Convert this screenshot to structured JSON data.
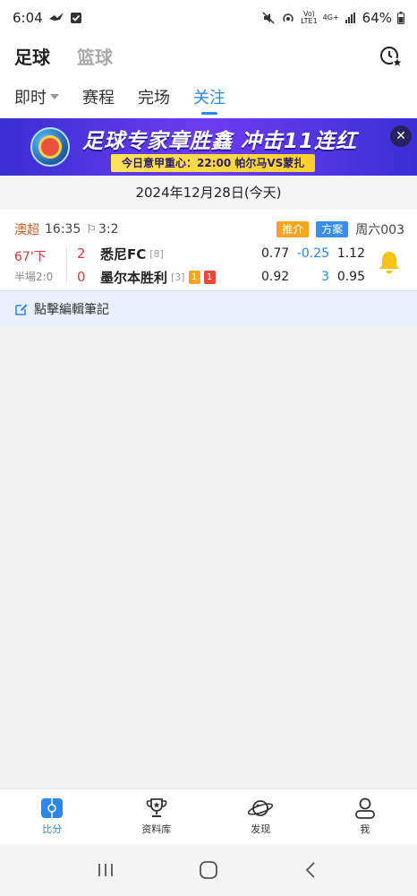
{
  "status_bar": {
    "time": "6:04",
    "volte": "Vo)",
    "lte": "LTE1",
    "network": "4G+",
    "battery": "64%"
  },
  "sports": [
    "足球",
    "篮球"
  ],
  "tabs": [
    {
      "label": "即时",
      "has_dropdown": true
    },
    {
      "label": "赛程"
    },
    {
      "label": "完场"
    },
    {
      "label": "关注",
      "active": true
    }
  ],
  "banner": {
    "headline": "足球专家章胜鑫 冲击11连红",
    "subline": "今日意甲重心：22:00 帕尔马VS蒙扎",
    "close": "✕"
  },
  "date": "2024年12月28日(今天)",
  "match": {
    "league": "澳超",
    "time": "16:35",
    "corners": "3:2",
    "tags": [
      "推介",
      "方案"
    ],
    "match_no": "周六003",
    "status": "67'下",
    "half_time": "半場2:0",
    "home": {
      "score": "2",
      "name": "悉尼FC",
      "rank": "[8]"
    },
    "away": {
      "score": "0",
      "name": "墨尔本胜利",
      "rank": "[3]",
      "yellow_cards": "1",
      "red_cards": "1"
    },
    "odds_home": [
      "0.77",
      "-0.25",
      "1.12"
    ],
    "odds_away": [
      "0.92",
      "3",
      "0.95"
    ]
  },
  "notes_label": "點擊編輯筆記",
  "bottom_nav": [
    {
      "label": "比分",
      "active": true
    },
    {
      "label": "资料库"
    },
    {
      "label": "发现"
    },
    {
      "label": "我"
    }
  ],
  "colors": {
    "accent": "#2e86e6",
    "live": "#e03a3a",
    "league": "#c0602a",
    "bell": "#f7c21a"
  }
}
